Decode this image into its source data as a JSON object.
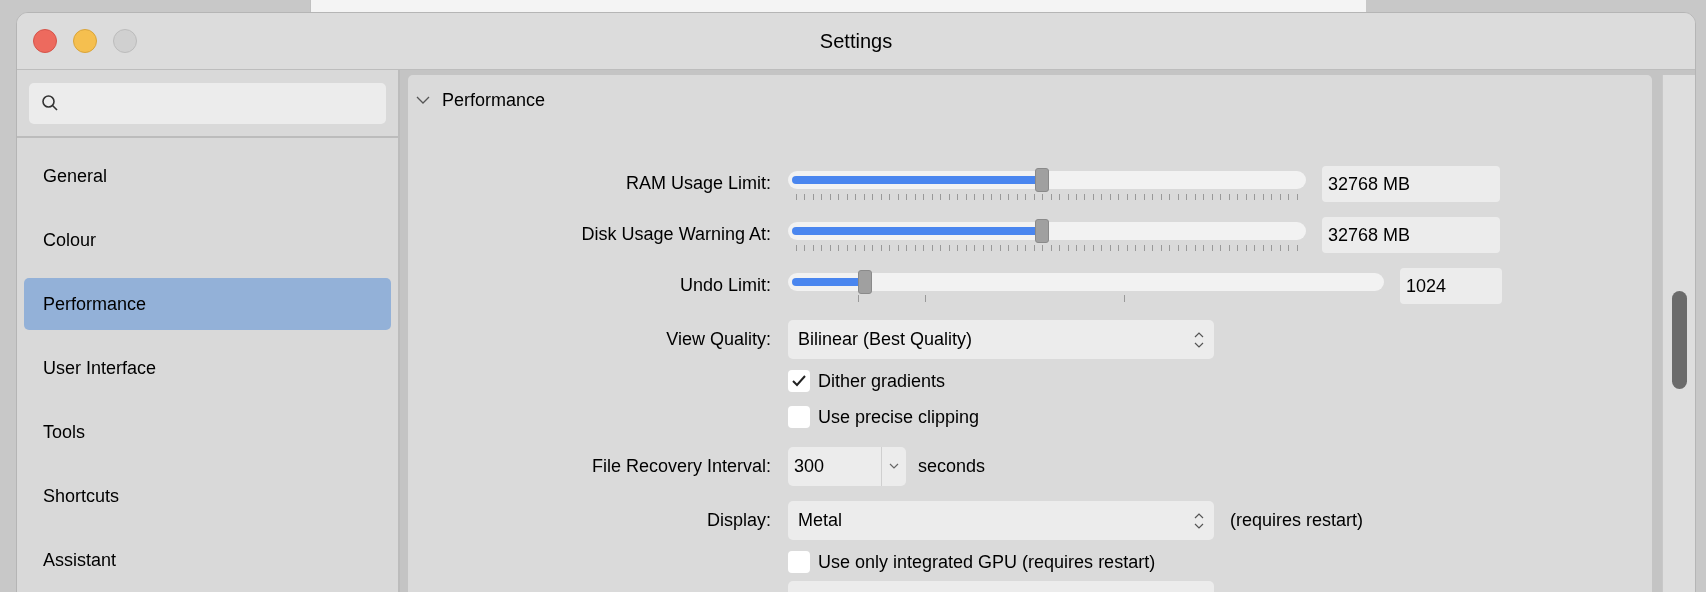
{
  "window": {
    "title": "Settings"
  },
  "sidebar": {
    "items": [
      {
        "label": "General",
        "selected": false
      },
      {
        "label": "Colour",
        "selected": false
      },
      {
        "label": "Performance",
        "selected": true
      },
      {
        "label": "User Interface",
        "selected": false
      },
      {
        "label": "Tools",
        "selected": false
      },
      {
        "label": "Shortcuts",
        "selected": false
      },
      {
        "label": "Assistant",
        "selected": false
      }
    ]
  },
  "section": {
    "title": "Performance",
    "expanded": true
  },
  "settings": [
    {
      "kind": "slider",
      "label": "RAM Usage Limit:",
      "level": 0.49,
      "value": "32768 MB"
    },
    {
      "kind": "slider",
      "label": "Disk Usage Warning At:",
      "level": 0.49,
      "value": "32768 MB"
    },
    {
      "kind": "stepslider",
      "label": "Undo Limit:",
      "level": 0.13,
      "value": "1024"
    },
    {
      "kind": "select",
      "label": "View Quality:",
      "value": "Bilinear (Best Quality)"
    },
    {
      "kind": "checkbox",
      "label": "Dither gradients",
      "checked": true
    },
    {
      "kind": "checkbox",
      "label": "Use precise clipping",
      "checked": false
    },
    {
      "kind": "combo",
      "label": "File Recovery Interval:",
      "value": "300",
      "suffix": "seconds"
    },
    {
      "kind": "select",
      "label": "Display:",
      "value": "Metal",
      "suffix": "(requires restart)"
    },
    {
      "kind": "checkbox",
      "label": "Use only integrated GPU (requires restart)",
      "checked": false
    },
    {
      "kind": "partial"
    }
  ]
}
